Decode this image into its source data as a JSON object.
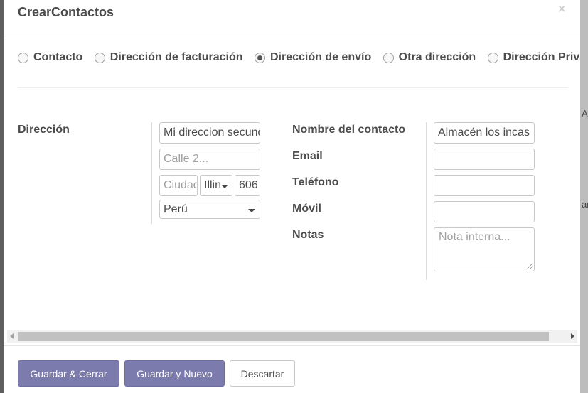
{
  "dialog": {
    "title": "CrearContactos",
    "close_symbol": "×"
  },
  "address_type": {
    "options": [
      {
        "label": "Contacto",
        "checked": false
      },
      {
        "label": "Dirección de facturación",
        "checked": false
      },
      {
        "label": "Dirección de envío",
        "checked": true
      },
      {
        "label": "Otra dirección",
        "checked": false
      },
      {
        "label": "Dirección Privada",
        "checked": false
      }
    ]
  },
  "address": {
    "label": "Dirección",
    "street": {
      "value": "Mi direccion secundaria"
    },
    "street2": {
      "placeholder": "Calle 2..."
    },
    "city": {
      "placeholder": "Ciudad"
    },
    "state": {
      "value": "Illinois"
    },
    "zip": {
      "value": "606"
    },
    "country": {
      "value": "Perú"
    }
  },
  "contact": {
    "name_label": "Nombre del contacto",
    "name_value": "Almacén los incas",
    "email_label": "Email",
    "email_value": "",
    "phone_label": "Teléfono",
    "phone_value": "",
    "mobile_label": "Móvil",
    "mobile_value": "",
    "notes_label": "Notas",
    "notes_placeholder": "Nota interna..."
  },
  "footer": {
    "save_close": "Guardar & Cerrar",
    "save_new": "Guardar y Nuevo",
    "discard": "Descartar"
  },
  "background": {
    "fragments": [
      "A",
      "an"
    ]
  },
  "colors": {
    "primary": "#7c7bad",
    "text": "#4c4c4c"
  }
}
